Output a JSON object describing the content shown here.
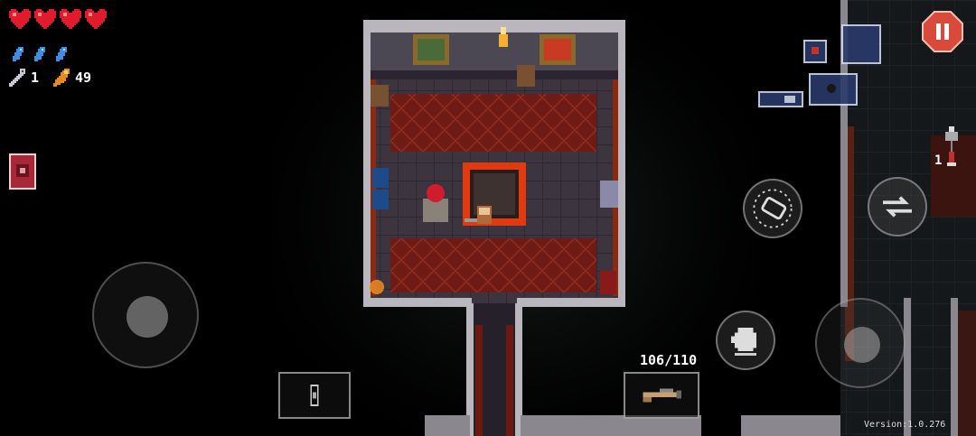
{
  "hud": {
    "hearts": 4,
    "blanks": 3,
    "keys": "1",
    "shells": "49",
    "key_right_count": "1",
    "ammo": "106/110",
    "version": "Version:1.0.276"
  },
  "colors": {
    "heart": "#e01c2c",
    "blank": "#3d8de0",
    "pause": "#d84a3a",
    "carpet": "#6a1a14",
    "floor": "#3a3438",
    "wall": "#b9b6bd"
  },
  "icons": {
    "pause": "pause-icon",
    "reload": "reload-icon",
    "swap": "swap-weapon-icon",
    "dodge": "dodge-roll-icon",
    "gun": "gun-icon",
    "item": "item-icon"
  }
}
